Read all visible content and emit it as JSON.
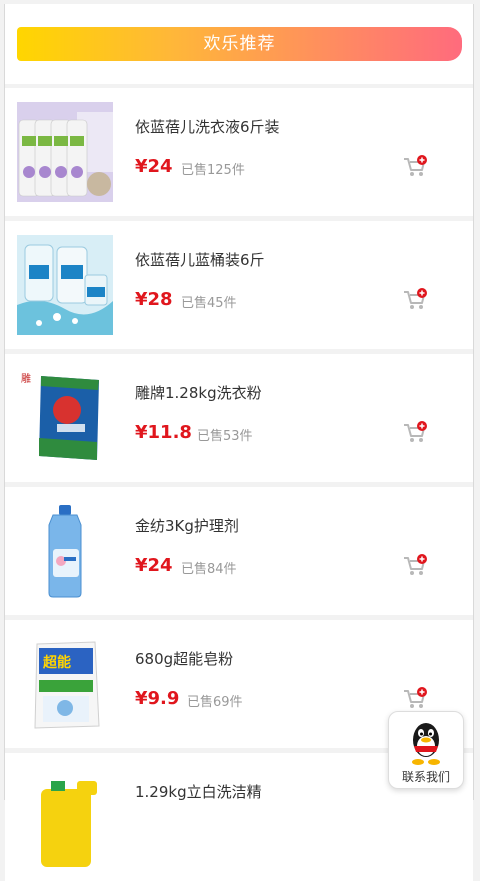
{
  "banner": {
    "title": "欢乐推荐"
  },
  "products": [
    {
      "name": "依蓝蓓儿洗衣液6斤装",
      "price": "¥24",
      "sold": "已售125件",
      "image": "laundry-liquid-bottles-image"
    },
    {
      "name": "依蓝蓓儿蓝桶装6斤",
      "price": "¥28",
      "sold": "已售45件",
      "image": "blue-laundry-bottles-image"
    },
    {
      "name": "雕牌1.28kg洗衣粉",
      "price": "¥11.8",
      "sold": "已售53件",
      "image": "detergent-powder-bag-image"
    },
    {
      "name": "金纺3Kg护理剂",
      "price": "¥24",
      "sold": "已售84件",
      "image": "fabric-softener-bottle-image"
    },
    {
      "name": "680g超能皂粉",
      "price": "¥9.9",
      "sold": "已售69件",
      "image": "soap-powder-bag-image"
    },
    {
      "name": "1.29kg立白洗洁精",
      "price": "",
      "sold": "",
      "image": "dish-soap-bottle-image"
    }
  ],
  "contact": {
    "label": "联系我们",
    "icon": "qq-penguin-icon"
  },
  "colors": {
    "price": "#e0161d",
    "banner_start": "#ffd600",
    "banner_end": "#ff6b7d"
  }
}
